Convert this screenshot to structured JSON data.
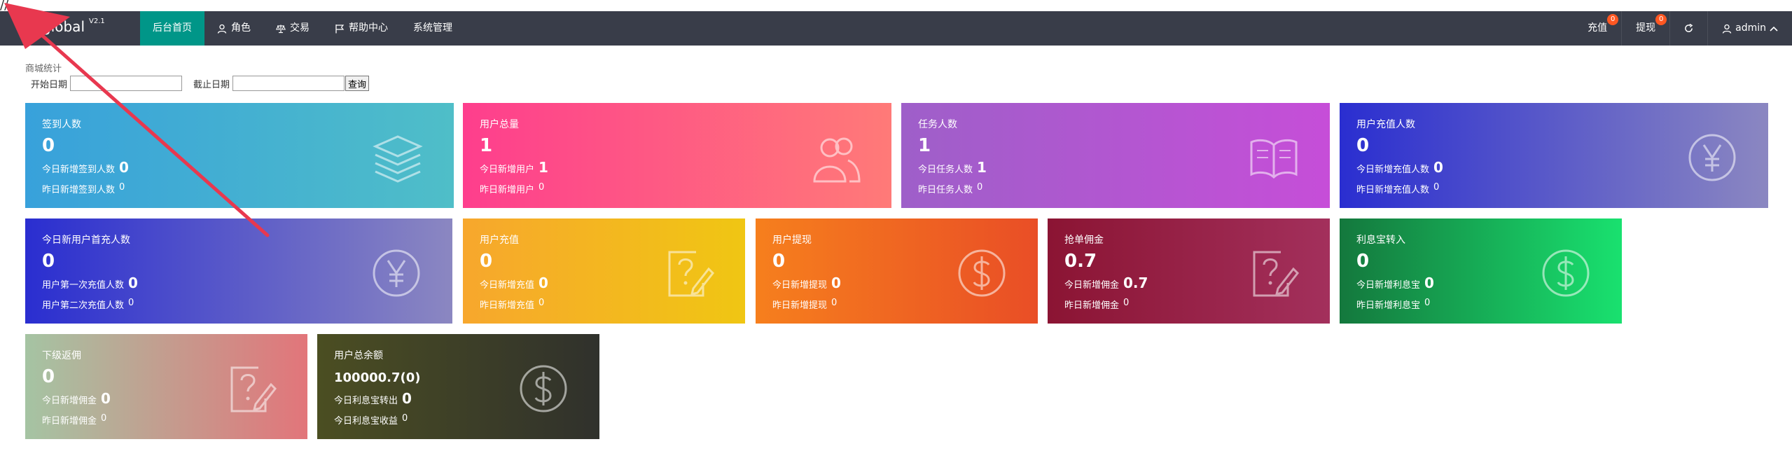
{
  "comment_text": "//",
  "header": {
    "logo": "global",
    "version": "V2.1",
    "nav": [
      {
        "label": "后台首页",
        "icon": "none"
      },
      {
        "label": "角色",
        "icon": "user-icon"
      },
      {
        "label": "交易",
        "icon": "balance-icon"
      },
      {
        "label": "帮助中心",
        "icon": "flag-icon"
      },
      {
        "label": "系统管理",
        "icon": "none"
      }
    ],
    "right": {
      "recharge": "充值",
      "recharge_badge": "0",
      "withdraw": "提现",
      "withdraw_badge": "0",
      "user": "admin"
    }
  },
  "stats": {
    "title": "商城统计",
    "start_label": "开始日期",
    "end_label": "截止日期",
    "query_button": "查询"
  },
  "cards": [
    {
      "title": "签到人数",
      "value": "0",
      "l1_label": "今日新增签到人数",
      "l1_value": "0",
      "l2_label": "昨日新增签到人数",
      "l2_value": "0",
      "icon": "layers-icon"
    },
    {
      "title": "用户总量",
      "value": "1",
      "l1_label": "今日新增用户",
      "l1_value": "1",
      "l2_label": "昨日新增用户",
      "l2_value": "0",
      "icon": "users-icon"
    },
    {
      "title": "任务人数",
      "value": "1",
      "l1_label": "今日任务人数",
      "l1_value": "1",
      "l2_label": "昨日任务人数",
      "l2_value": "0",
      "icon": "book-icon"
    },
    {
      "title": "用户充值人数",
      "value": "0",
      "l1_label": "今日新增充值人数",
      "l1_value": "0",
      "l2_label": "昨日新增充值人数",
      "l2_value": "0",
      "icon": "yen-icon"
    },
    {
      "title": "今日新用户首充人数",
      "value": "0",
      "l1_label": "用户第一次充值人数",
      "l1_value": "0",
      "l2_label": "用户第二次充值人数",
      "l2_value": "0",
      "icon": "yen-icon"
    },
    {
      "title": "用户充值",
      "value": "0",
      "l1_label": "今日新增充值",
      "l1_value": "0",
      "l2_label": "昨日新增充值",
      "l2_value": "0",
      "icon": "help-edit-icon"
    },
    {
      "title": "用户提现",
      "value": "0",
      "l1_label": "今日新增提现",
      "l1_value": "0",
      "l2_label": "昨日新增提现",
      "l2_value": "0",
      "icon": "dollar-icon"
    },
    {
      "title": "抢单佣金",
      "value": "0.7",
      "l1_label": "今日新增佣金",
      "l1_value": "0.7",
      "l2_label": "昨日新增佣金",
      "l2_value": "0",
      "icon": "help-edit-icon"
    },
    {
      "title": "利息宝转入",
      "value": "0",
      "l1_label": "今日新增利息宝",
      "l1_value": "0",
      "l2_label": "昨日新增利息宝",
      "l2_value": "0",
      "icon": "dollar-icon"
    },
    {
      "title": "下级返佣",
      "value": "0",
      "l1_label": "今日新增佣金",
      "l1_value": "0",
      "l2_label": "昨日新增佣金",
      "l2_value": "0",
      "icon": "help-edit-icon"
    },
    {
      "title": "用户总余额",
      "value": "100000.7(0)",
      "l1_label": "今日利息宝转出",
      "l1_value": "0",
      "l2_label": "今日利息宝收益",
      "l2_value": "0",
      "icon": "dollar-icon"
    }
  ],
  "colors": {
    "topbar": "#393d49",
    "active_nav": "#009688",
    "badge": "#ff5722",
    "arrow": "#e8384f"
  }
}
